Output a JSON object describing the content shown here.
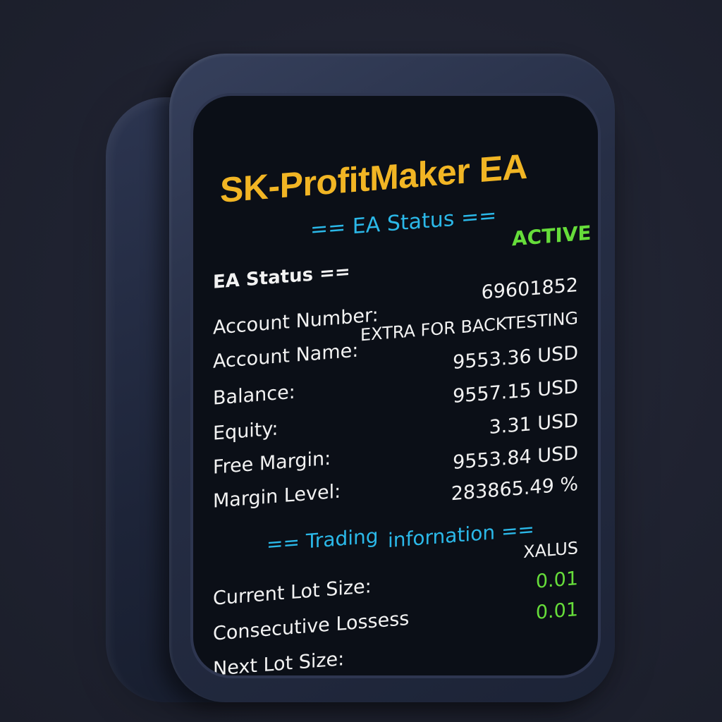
{
  "title": "SK-ProfitMaker EA",
  "status_section": {
    "header": "== EA Status ==",
    "state": "ACTIVE",
    "sub_label": "EA Status =="
  },
  "account": {
    "number_label": "Account Number:",
    "number_value": "69601852",
    "name_label": "Account Name:",
    "name_value": "EXTRA FOR BACKTESTING",
    "balance_label": "Balance:",
    "balance_value": "9553.36 USD",
    "equity_label": "Equity:",
    "equity_value": "9557.15 USD",
    "free_margin_label": "Free Margin:",
    "free_margin_value": "3.31 USD",
    "margin_level_label": "Margin Level:",
    "margin_level_value": "9553.84 USD",
    "extra_value": "283865.49 %"
  },
  "trading_section": {
    "header_part1": "== Trading",
    "header_part2": "infornation ==",
    "symbol_value": "XALUS",
    "current_lot_label": "Current Lot Size:",
    "current_lot_value": "0.01",
    "consecutive_losses_label": "Consecutive Lossess",
    "consecutive_losses_value": "0.01",
    "next_lot_label": "Next Lot Size:"
  },
  "colors": {
    "title": "#f1b524",
    "section": "#2bb8e8",
    "active": "#66dd3a",
    "text": "#f2f2f2",
    "screen": "#0b0f17"
  }
}
